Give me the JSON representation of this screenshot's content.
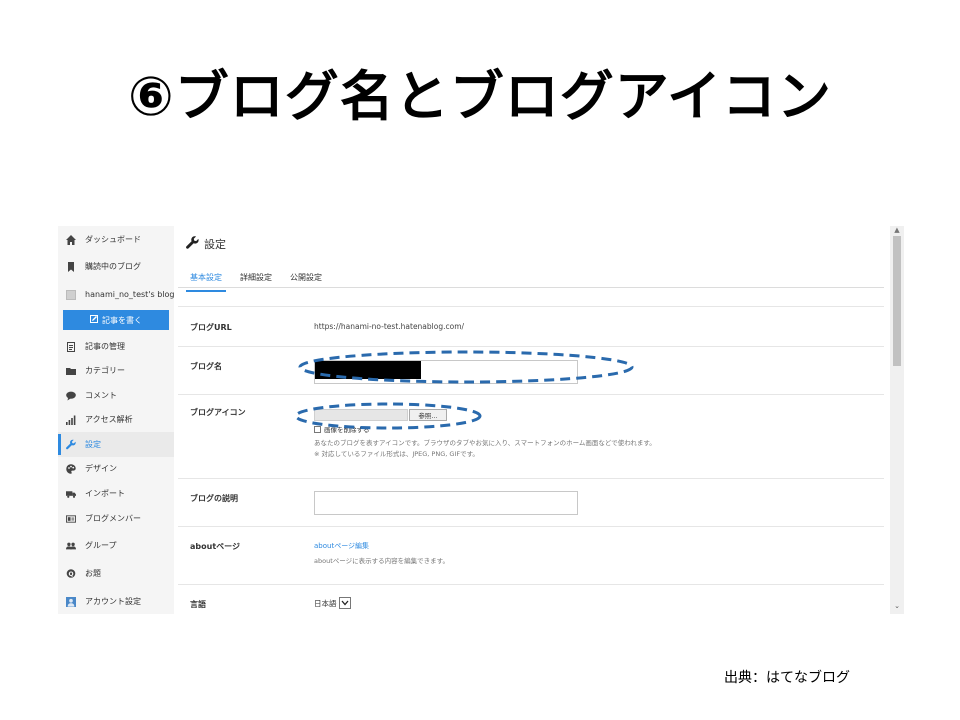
{
  "slide": {
    "title": "⑥ブログ名とブログアイコン",
    "source": "出典：はてなブログ"
  },
  "sidebar": {
    "items": [
      {
        "label": "ダッシュボード",
        "icon": "home-icon"
      },
      {
        "label": "購読中のブログ",
        "icon": "bookmark-icon"
      },
      {
        "label": "hanami_no_test's blog",
        "icon": "blog-avatar-icon"
      },
      {
        "label": "記事の管理",
        "icon": "document-icon"
      },
      {
        "label": "カテゴリー",
        "icon": "folder-icon"
      },
      {
        "label": "コメント",
        "icon": "comment-icon"
      },
      {
        "label": "アクセス解析",
        "icon": "bar-chart-icon"
      },
      {
        "label": "設定",
        "icon": "wrench-icon"
      },
      {
        "label": "デザイン",
        "icon": "palette-icon"
      },
      {
        "label": "インポート",
        "icon": "truck-icon"
      },
      {
        "label": "ブログメンバー",
        "icon": "member-card-icon"
      },
      {
        "label": "グループ",
        "icon": "group-icon"
      },
      {
        "label": "お題",
        "icon": "topic-icon"
      },
      {
        "label": "アカウント設定",
        "icon": "account-icon"
      }
    ],
    "write_button": "記事を書く"
  },
  "main": {
    "page_title": "設定",
    "tabs": [
      {
        "label": "基本設定",
        "active": true
      },
      {
        "label": "詳細設定",
        "active": false
      },
      {
        "label": "公開設定",
        "active": false
      }
    ],
    "rows": {
      "blog_url": {
        "label": "ブログURL",
        "value": "https://hanami-no-test.hatenablog.com/"
      },
      "blog_name": {
        "label": "ブログ名"
      },
      "blog_icon": {
        "label": "ブログアイコン",
        "browse_button": "参照...",
        "delete_checkbox": "画像を削除する",
        "note1": "あなたのブログを表すアイコンです。ブラウザのタブやお気に入り、スマートフォンのホーム画面などで使われます。",
        "note2": "※ 対応しているファイル形式は、JPEG, PNG, GIFです。"
      },
      "blog_description": {
        "label": "ブログの説明"
      },
      "about_page": {
        "label": "aboutページ",
        "link": "aboutページ編集",
        "note": "aboutページに表示する内容を編集できます。"
      },
      "language": {
        "label": "言語",
        "value": "日本語"
      }
    }
  },
  "colors": {
    "accent": "#2e8ae0",
    "annotation": "#2a6aad"
  }
}
